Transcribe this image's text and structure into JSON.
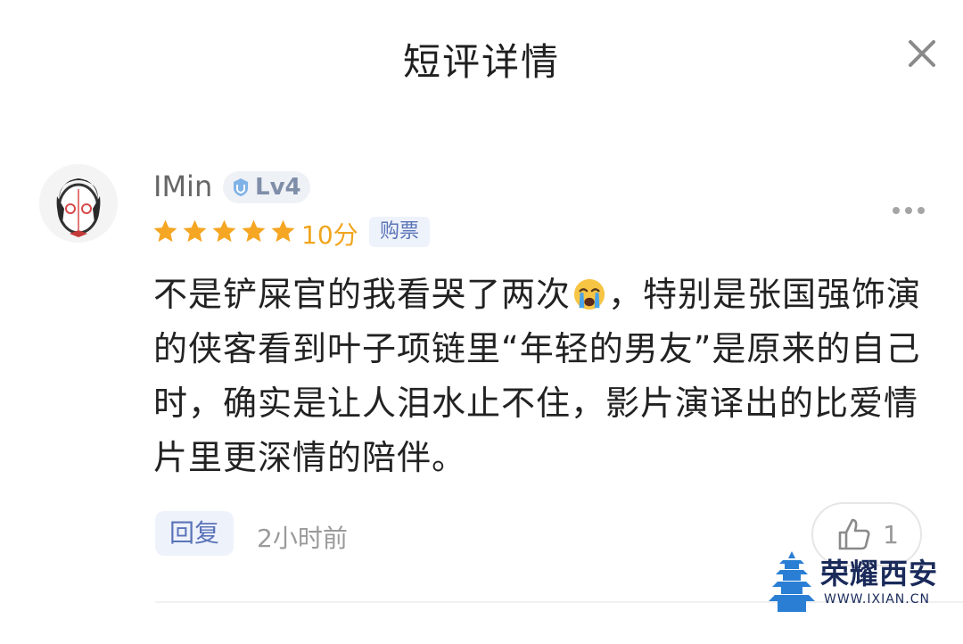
{
  "header": {
    "title": "短评详情"
  },
  "comment": {
    "username": "IMin",
    "level": "Lv4",
    "stars": 5,
    "score": "10分",
    "tag": "购票",
    "text_part1": "不是铲屎官的我看哭了两次",
    "emoji": "crying-face",
    "text_part2": "，特别是张国强饰演的侠客看到叶子项链里“年轻的男友”是原来的自己时，确实是让人泪水止不住，影片演译出的比爱情片里更深情的陪伴。",
    "reply_label": "回复",
    "time": "2小时前",
    "likes": "1"
  },
  "watermark": {
    "text": "荣耀西安",
    "url": "WWW.IXIAN.CN"
  },
  "colors": {
    "star": "#f5a623",
    "accent": "#5a74b8",
    "watermark": "#1a2a5a"
  }
}
